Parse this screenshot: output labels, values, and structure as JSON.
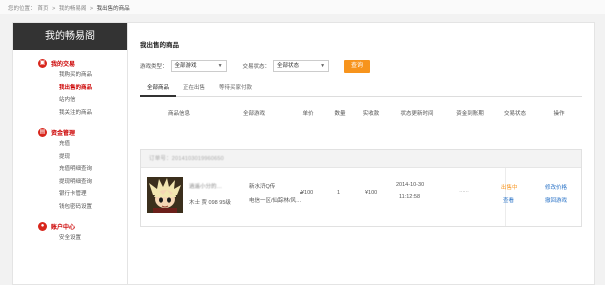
{
  "breadcrumb": {
    "label": "您的位置：",
    "home": "首页",
    "sep1": ">",
    "parent": "我的畅易阁",
    "sep2": ">",
    "current": "我出售的商品"
  },
  "sidebar": {
    "title": "我的畅易阁",
    "groups": [
      {
        "heading": "我的交易",
        "icon": "shopping-bag-icon",
        "items": [
          "我购买的商品",
          "我出售的商品",
          "站内信",
          "我关注的商品"
        ],
        "active_index": 1
      },
      {
        "heading": "资金管理",
        "icon": "wallet-icon",
        "items": [
          "充值",
          "提现",
          "充值明细查询",
          "提现明细查询",
          "银行卡管理",
          "钱包密码设置"
        ]
      },
      {
        "heading": "账户中心",
        "icon": "user-icon",
        "items": [
          "安全设置"
        ]
      }
    ]
  },
  "main": {
    "title": "我出售的商品",
    "filters": {
      "game_label": "游戏类型：",
      "game_value": "全部游戏",
      "status_label": "交易状态：",
      "status_value": "全部状态",
      "query_button": "查询"
    },
    "tabs": [
      "全部商品",
      "正在出售",
      "等待买家付款"
    ],
    "active_tab": 0,
    "columns": [
      "商品信息",
      "全部游戏",
      "单价",
      "数量",
      "实收款",
      "状态更新时间",
      "资金到账期",
      "交易状态",
      "操作"
    ],
    "order": {
      "order_no": "订单号：2014103019960650",
      "product_name": "逍遥小分的…",
      "seller": "木士 贾 098 95级",
      "game": "新水浒Q传",
      "server": "电信一区/仙踪林/风…",
      "unit_price": "¥100",
      "quantity": "1",
      "received": "¥100",
      "update_date": "2014-10-30",
      "update_time": "11:12:58",
      "fund_period": "……",
      "status": "出售中",
      "status_link": "查看",
      "action_modify": "修改价格",
      "action_withdraw": "撤回游戏"
    }
  },
  "colors": {
    "accent": "#f7941d",
    "sidebar_header": "#333333",
    "active_red": "#cc0000",
    "link_blue": "#2a73c7"
  }
}
